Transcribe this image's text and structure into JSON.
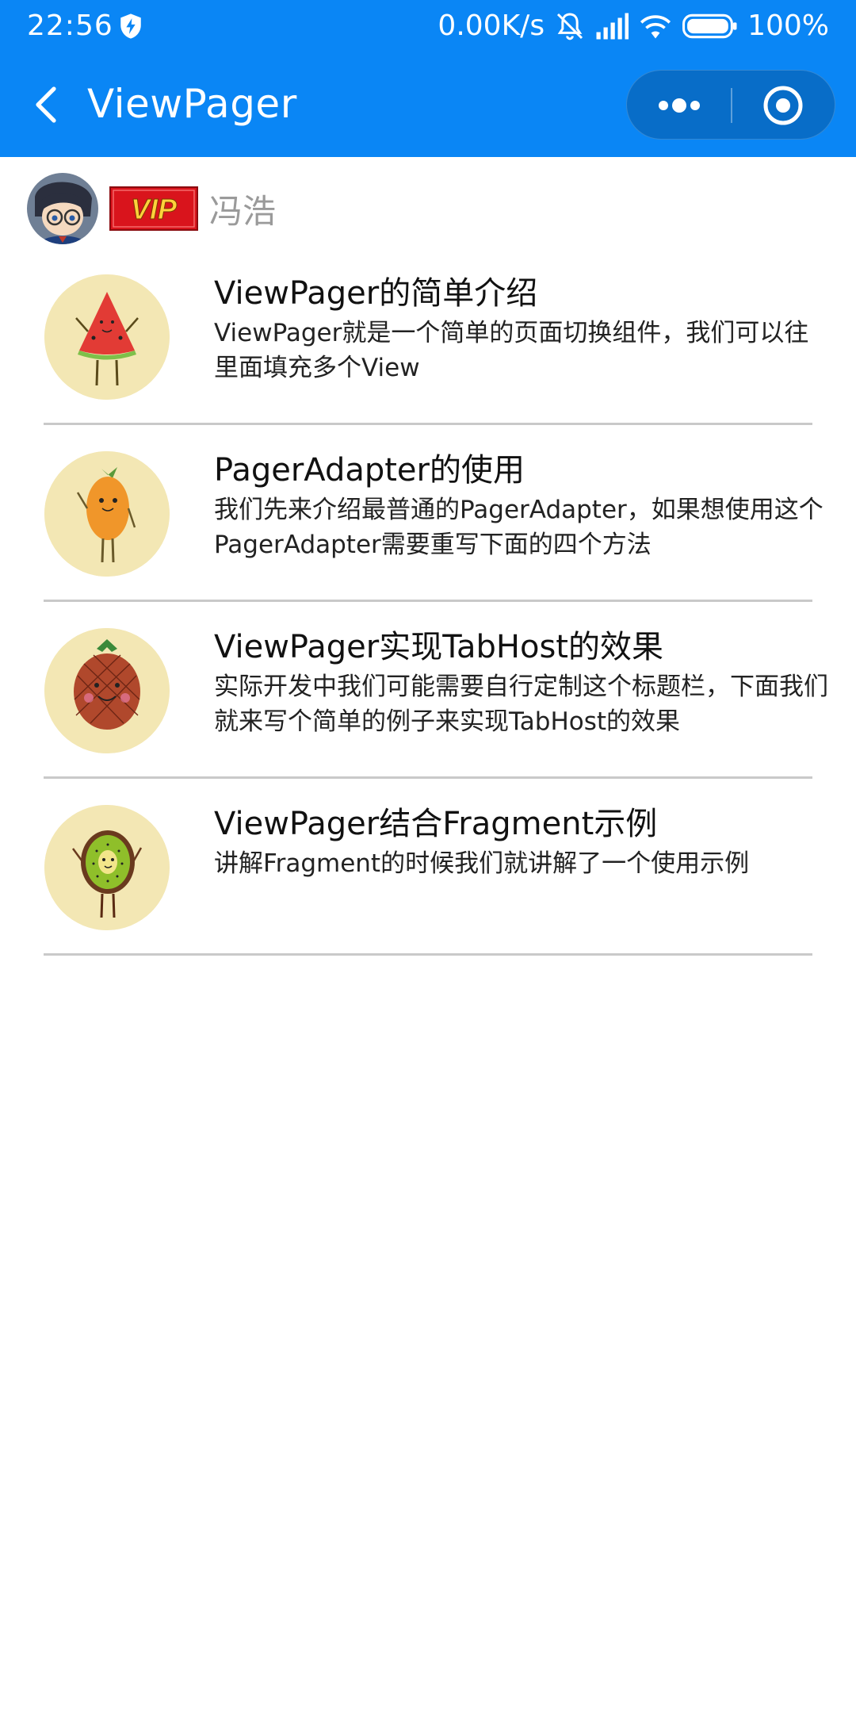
{
  "status_bar": {
    "time": "22:56",
    "network_speed": "0.00K/s",
    "battery": "100%",
    "icons": [
      "shield-icon",
      "mute-bell-icon",
      "signal-icon",
      "wifi-icon",
      "battery-icon"
    ]
  },
  "nav": {
    "title": "ViewPager",
    "accent_color": "#0a86f5"
  },
  "author": {
    "vip_label": "VIP",
    "name": "冯浩"
  },
  "items": [
    {
      "title": " ViewPager的简单介绍",
      "desc": "ViewPager就是一个简单的页面切换组件，我们可以往里面填充多个View",
      "icon": "watermelon-icon"
    },
    {
      "title": "PagerAdapter的使用",
      "desc": "我们先来介绍最普通的PagerAdapter，如果想使用这个PagerAdapter需要重写下面的四个方法",
      "icon": "mango-icon"
    },
    {
      "title": "ViewPager实现TabHost的效果",
      "desc": "实际开发中我们可能需要自行定制这个标题栏，下面我们就来写个简单的例子来实现TabHost的效果",
      "icon": "pineapple-icon"
    },
    {
      "title": "ViewPager结合Fragment示例",
      "desc": "讲解Fragment的时候我们就讲解了一个使用示例",
      "icon": "kiwi-icon"
    }
  ]
}
